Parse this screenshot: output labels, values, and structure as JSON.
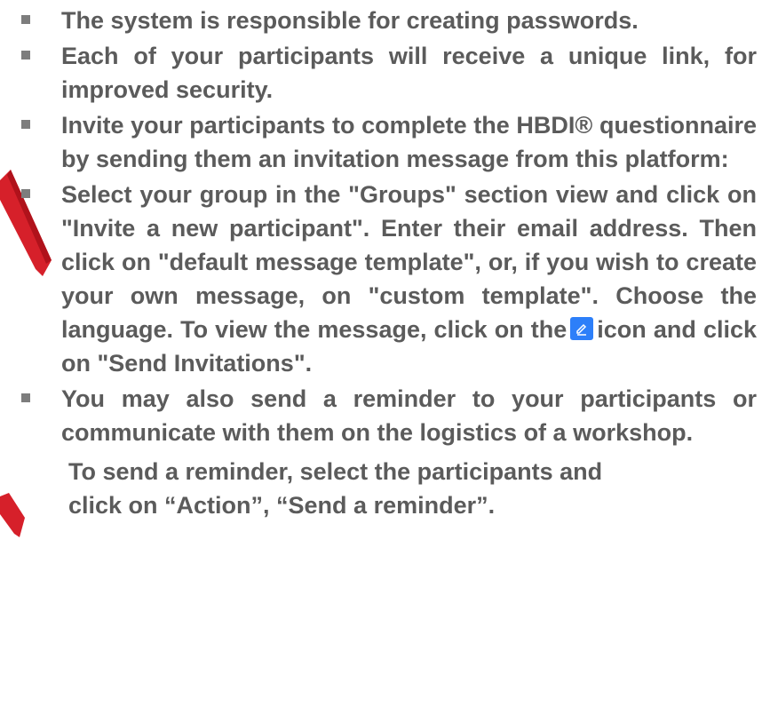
{
  "bullets": [
    {
      "text": "The system is responsible for creating passwords."
    },
    {
      "text": "Each of your participants will receive a unique link, for improved security."
    },
    {
      "text": "Invite your participants to complete the HBDI® questionnaire by sending them an invitation message from this platform:"
    },
    {
      "text_before_icon": "Select your group in the \"Groups\" section view and click on \"Invite a new participant\". Enter their email address. Then click on \"default message template\", or, if you wish to create your own message, on \"custom template\". Choose the language. To view the message, click on the",
      "icon": "edit-pencil-icon",
      "text_after_icon": "icon and click on \"Send Invitations\"."
    },
    {
      "text": "You may also send a reminder to your participants or communicate with them on the logistics of a workshop."
    }
  ],
  "continuation": {
    "line1": "To send a reminder, select the participants and",
    "line2": "click on “Action”, “Send a reminder”."
  },
  "colors": {
    "text": "#5b5b5b",
    "bullet": "#7d7d7d",
    "edit_icon": "#2d7ff9",
    "arrow": "#d6202a"
  }
}
